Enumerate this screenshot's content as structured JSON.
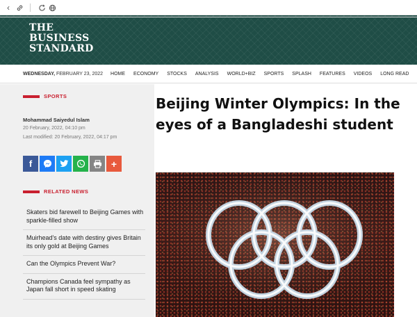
{
  "browser": {
    "icons": [
      "back-icon",
      "link-icon",
      "reload-icon",
      "globe-icon"
    ]
  },
  "masthead": {
    "logo_line1": "THE",
    "logo_line2": "BUSINESS",
    "logo_line3": "STANDARD"
  },
  "nav": {
    "weekday": "WEDNESDAY,",
    "date": "FEBRUARY 23, 2022",
    "items": [
      "HOME",
      "ECONOMY",
      "STOCKS",
      "ANALYSIS",
      "WORLD+BIZ",
      "SPORTS",
      "SPLASH",
      "FEATURES",
      "VIDEOS",
      "LONG READ"
    ]
  },
  "sidebar": {
    "section": "SPORTS",
    "author": "Mohammad Saiyedul Islam",
    "published": "20 February, 2022, 04:10 pm",
    "modified": "Last modified: 20 February, 2022, 04:17 pm",
    "share_icons": [
      "facebook-icon",
      "messenger-icon",
      "twitter-icon",
      "whatsapp-icon",
      "print-icon",
      "more-plus-icon"
    ],
    "related_title": "RELATED NEWS",
    "related": [
      "Skaters bid farewell to Beijing Games with sparkle-filled show",
      "Muirhead's date with destiny gives Britain its only gold at Beijing Games",
      "Can the Olympics Prevent War?",
      "Champions Canada feel sympathy as Japan fall short in speed skating"
    ]
  },
  "article": {
    "headline": "Beijing Winter Olympics: In the eyes of a Bangladeshi student"
  },
  "colors": {
    "masthead": "#1f4d46",
    "accent_red": "#c9202f"
  }
}
